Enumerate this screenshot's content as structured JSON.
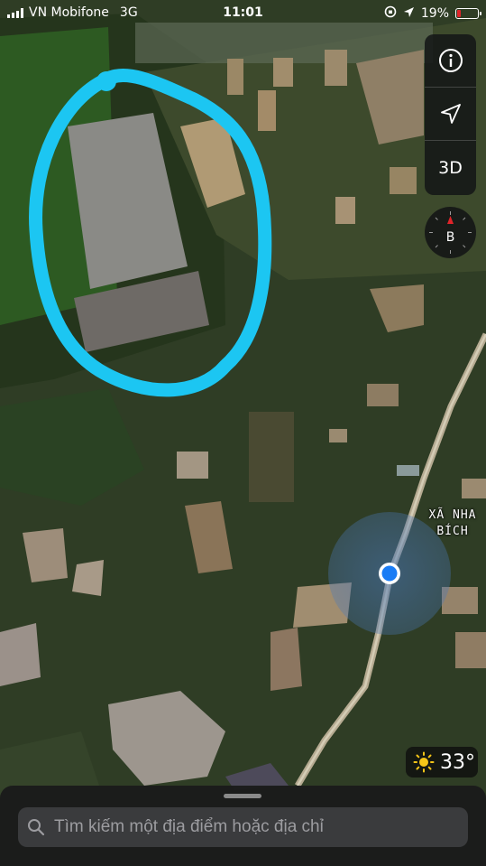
{
  "status_bar": {
    "carrier": "VN Mobifone",
    "network": "3G",
    "time": "11:01",
    "battery_percent": "19%",
    "battery_level": 0.19,
    "battery_color": "#e0242a"
  },
  "map": {
    "type": "satellite",
    "place_label_lines": [
      "XÃ NHA",
      "BÍCH"
    ],
    "highlight_color": "#1cc6f2",
    "user_location_color": "#1a7cf5"
  },
  "controls": {
    "info_icon": "info-icon",
    "location_icon": "location-arrow-icon",
    "view_3d_label": "3D",
    "compass_label": "B"
  },
  "weather": {
    "icon": "sun-icon",
    "temperature": "33°"
  },
  "search": {
    "placeholder": "Tìm kiếm một địa điểm hoặc địa chỉ",
    "icon": "search-icon"
  }
}
